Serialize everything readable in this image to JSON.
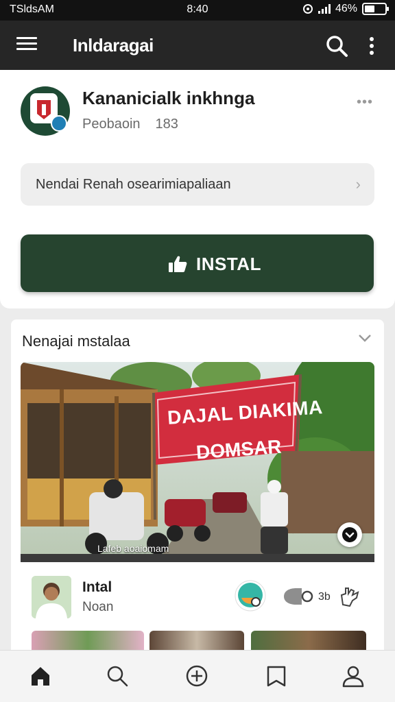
{
  "status_bar": {
    "carrier": "TSldsAM",
    "time": "8:40",
    "battery_text": "46%",
    "icons": [
      "vpn-icon",
      "signal-icon",
      "battery-icon"
    ]
  },
  "app_bar": {
    "title": "Inldaragai",
    "icons": [
      "menu-icon",
      "search-icon",
      "more-vert-icon"
    ]
  },
  "app_info": {
    "name": "Kananicialk inkhnga",
    "publisher": "Peobaoin",
    "count": "183",
    "info_row_text": "Nendai Renah osearimiapaliaan",
    "install_label": "INSTAL"
  },
  "section": {
    "title": "Nenajai mstalaa",
    "banner_line1": "DAJAL DIAKIMA",
    "banner_line2": "DOMSAR",
    "caption": "Lafeb aoaiomam"
  },
  "post": {
    "title": "Intal",
    "subtitle": "Noan",
    "share_count": "3b"
  },
  "bottom_nav": {
    "items": [
      "home-icon",
      "search-icon",
      "add-circle-icon",
      "bookmark-icon",
      "profile-icon"
    ]
  },
  "colors": {
    "install_button": "#26442f",
    "app_bar": "#262626",
    "banner_red": "#d22d3e",
    "app_icon_bg": "#1e4a34"
  }
}
